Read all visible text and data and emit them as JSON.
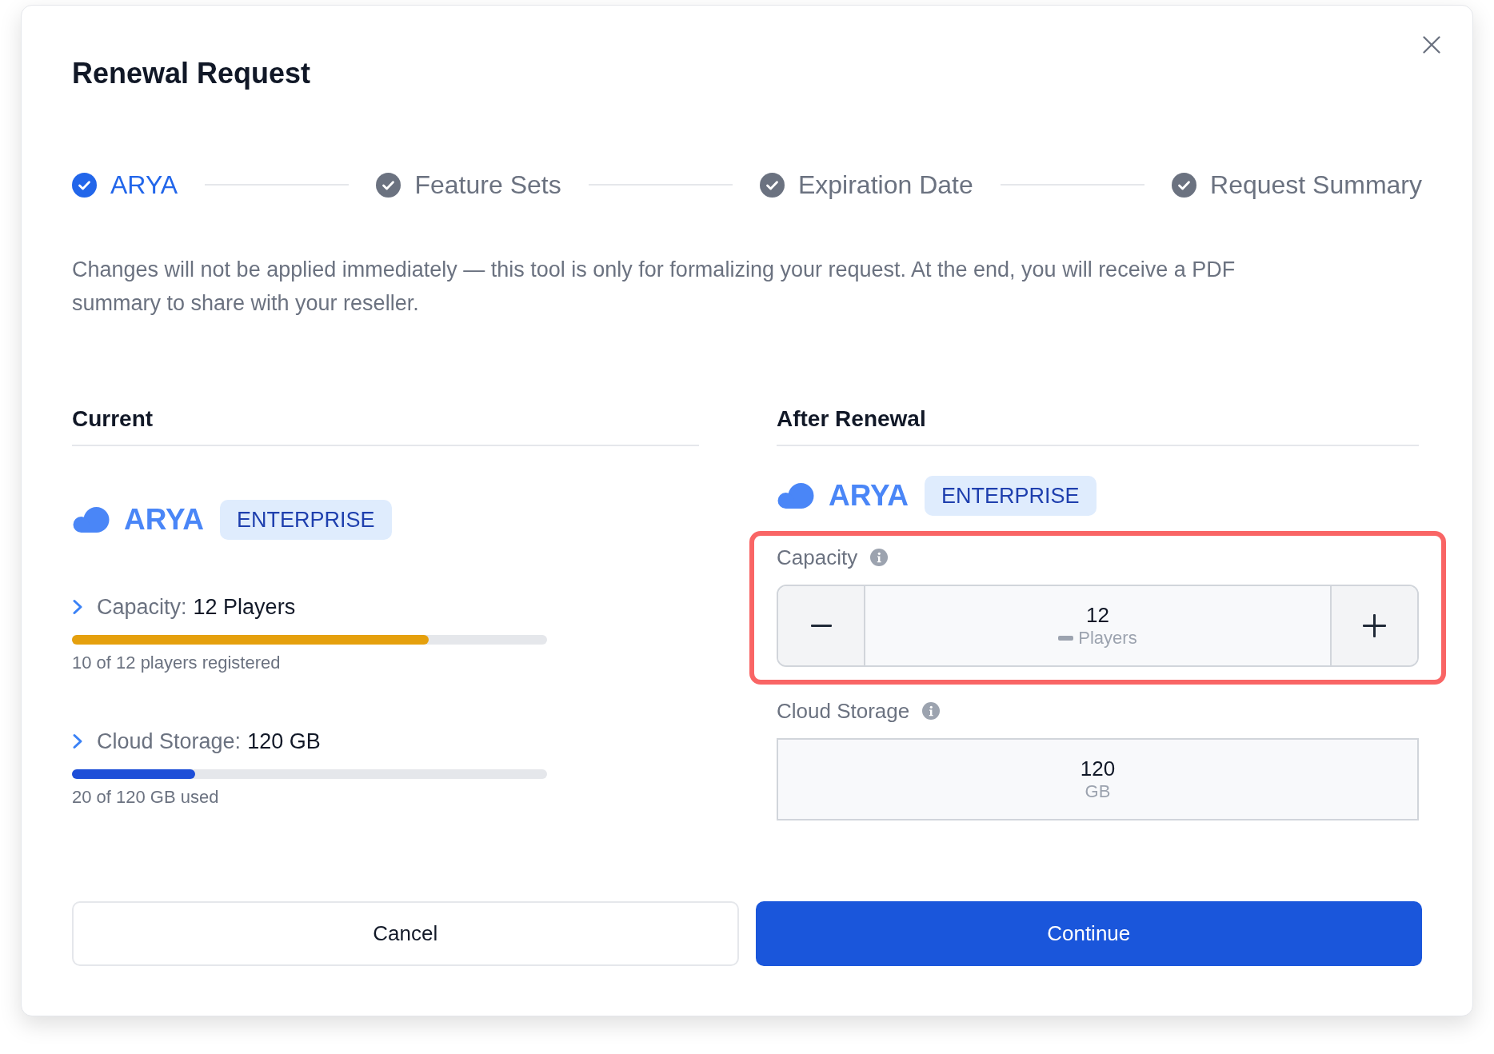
{
  "dialog": {
    "title": "Renewal Request"
  },
  "steps": [
    {
      "label": "ARYA",
      "selected": true
    },
    {
      "label": "Feature Sets",
      "selected": false
    },
    {
      "label": "Expiration Date",
      "selected": false
    },
    {
      "label": "Request Summary",
      "selected": false
    }
  ],
  "notice": "Changes will not be applied immediately — this tool is only for formalizing your request. At the end, you will receive a PDF summary to share with your reseller.",
  "current": {
    "heading": "Current",
    "product": {
      "name": "ARYA",
      "badge": "ENTERPRISE"
    },
    "metrics": [
      {
        "label": "Capacity:",
        "value": "12 Players",
        "expanded": false,
        "level": 0.75,
        "color": "#e5a00d",
        "caption": "10 of 12 players registered"
      },
      {
        "label": "Cloud Storage:",
        "value": "120 GB",
        "expanded": false,
        "level": 0.26,
        "color": "#1d4ed8",
        "caption": "20 of 120 GB used"
      }
    ]
  },
  "after_renewal": {
    "heading": "After Renewal",
    "product": {
      "name": "ARYA",
      "badge": "ENTERPRISE"
    },
    "fields": [
      {
        "kind": "stepper",
        "label": "Capacity",
        "value": "12",
        "unit": "Players",
        "highlighted": true
      },
      {
        "kind": "display",
        "label": "Cloud Storage",
        "value": "120",
        "unit": "GB",
        "highlighted": false
      }
    ]
  },
  "buttons": [
    {
      "label": "Cancel",
      "kind": "secondary"
    },
    {
      "label": "Continue",
      "kind": "primary"
    }
  ]
}
